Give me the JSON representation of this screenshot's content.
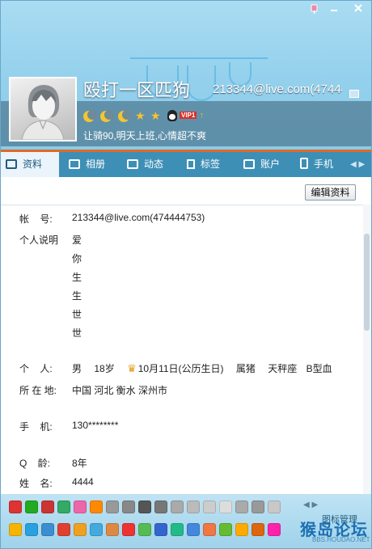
{
  "window": {
    "controls": [
      "pin-icon",
      "minimize-icon",
      "close-icon"
    ]
  },
  "profile": {
    "nickname": "殴打一区匹狗",
    "account_short": "213344@live.com(474444",
    "signature": "让骑90,明天上班,心情超不爽",
    "level": {
      "moons": 3,
      "stars": 2
    },
    "vip_label": "VIP1",
    "colors": {
      "accent": "#e06a26",
      "tabbar": "#3e8fb6",
      "header_bg": "#93d0ec"
    }
  },
  "tabs": [
    {
      "label": "资料",
      "icon": "profile-card-icon",
      "active": true
    },
    {
      "label": "相册",
      "icon": "photo-album-icon",
      "active": false
    },
    {
      "label": "动态",
      "icon": "feed-list-icon",
      "active": false
    },
    {
      "label": "标签",
      "icon": "bookmark-icon",
      "active": false
    },
    {
      "label": "账户",
      "icon": "wallet-icon",
      "active": false
    },
    {
      "label": "手机",
      "icon": "phone-icon",
      "active": false
    }
  ],
  "content": {
    "edit_button": "编辑资料",
    "fields": {
      "account_label": "帐    号:",
      "account_value": "213344@live.com(474444753)",
      "bio_label": "个人说明",
      "bio_lines": [
        "爱",
        "你",
        "生",
        "生",
        "世",
        "世"
      ],
      "personal_label": "个    人:",
      "gender": "男",
      "age": "18岁",
      "birthday": "10月11日(公历生日)",
      "zodiac": "属猪",
      "star_sign": "天秤座",
      "blood_type": "B型血",
      "location_label": "所 在 地:",
      "location_value": "中国 河北 衡水 深州市",
      "phone_label": "手    机:",
      "phone_value": "130********",
      "qage_label": "Q    龄:",
      "qage_value": "8年",
      "name_label": "姓    名:",
      "name_value": "4444"
    }
  },
  "bottom": {
    "manage_label": "图标管理",
    "watermark": "猴岛论坛",
    "watermark_url": "BBS.HOUDAO.NET",
    "row1_colors": [
      "#d33",
      "#2a2",
      "#c33",
      "#3a6",
      "#e6a",
      "#f80",
      "#999",
      "#888",
      "#555",
      "#777",
      "#aaa",
      "#bbb",
      "#ccc",
      "#ddd",
      "#aaa",
      "#999",
      "#c8c8c8"
    ],
    "row2_colors": [
      "#f5b400",
      "#29a0e0",
      "#3b8fd0",
      "#e04030",
      "#f0a020",
      "#44aadd",
      "#d84",
      "#e33",
      "#5b5",
      "#36c",
      "#2b8",
      "#48d",
      "#e74",
      "#6b3",
      "#fa0",
      "#d61",
      "#f2a"
    ]
  }
}
